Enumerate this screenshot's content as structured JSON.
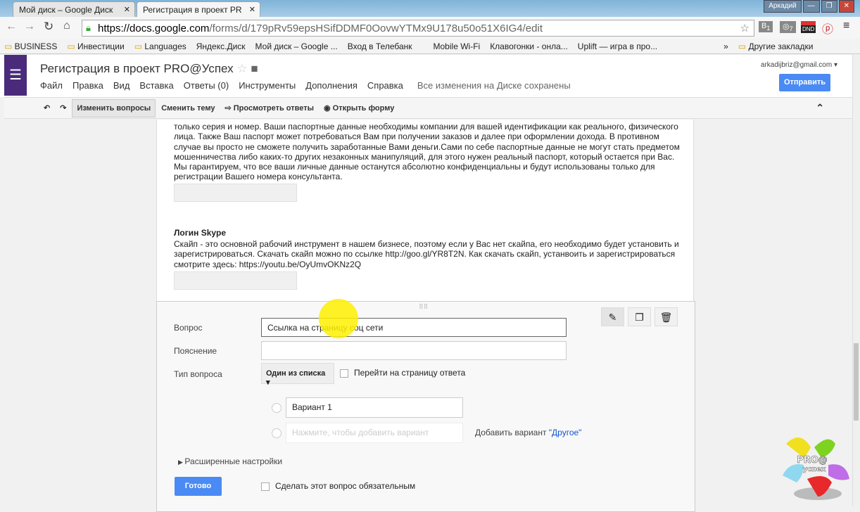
{
  "browser": {
    "tabs": [
      {
        "label": "Мой диск – Google Диск"
      },
      {
        "label": "Регистрация в проект PR"
      }
    ],
    "user": "Аркадий",
    "url_host": "https://docs.google.com",
    "url_path": "/forms/d/179pRv59epsHSifDDMF0OovwYTMx9U178u50o51X6IG4/edit",
    "bookmarks": [
      "BUSINESS",
      "Инвестиции",
      "Languages",
      "Яндекс.Диск",
      "Мой диск – Google ...",
      "Вход в Телебанк",
      "Mobile Wi-Fi",
      "Клавогонки - онла...",
      "Uplift — игра в про..."
    ],
    "other_bookmarks": "Другие закладки",
    "ext_badges": [
      "1",
      "7",
      "DND"
    ]
  },
  "app": {
    "title": "Регистрация в проект PRO@Успех",
    "menus": [
      "Файл",
      "Правка",
      "Вид",
      "Вставка",
      "Ответы (0)",
      "Инструменты",
      "Дополнения",
      "Справка"
    ],
    "saved_status": "Все изменения на Диске сохранены",
    "email": "arkadijbriz@gmail.com",
    "send_label": "Отправить"
  },
  "toolbar": {
    "edit_questions": "Изменить вопросы",
    "change_theme": "Сменить тему",
    "view_responses": "Просмотреть ответы",
    "open_form": "Открыть форму"
  },
  "form": {
    "passport_help": "только серия и номер. Ваши паспортные данные необходимы компании для вашей идентификации как реального, физического лица. Также Ваш паспорт может потребоваться Вам при получении заказов и далее при оформлении дохода. В противном случае вы просто не сможете получить заработанные Вами деньги.Сами по себе паспортные данные не могут стать предметом мошенничества либо каких-то других незаконных манипуляций, для этого нужен реальный паспорт, который остается при Вас. Мы гарантируем, что все ваши личные данные останутся абсолютно конфиденциальны и будут использованы только для регистрации Вашего номера консультанта.",
    "skype_title": "Логин Skype",
    "skype_help": "Скайп - это основной рабочий инструмент в нашем бизнесе, поэтому если у Вас нет скайпа, его необходимо будет установить и зарегистрироваться. Скачать скайп можно по ссылке http://goo.gl/YR8T2N. Как скачать скайп, устанвоить и зарегистрироваться смотрите здесь: https://youtu.be/OyUmvOKNz2Q",
    "editor": {
      "question_label": "Вопрос",
      "question_value": "Ссылка на страницу соц сети",
      "help_label": "Пояснение",
      "help_value": "",
      "type_label": "Тип вопроса",
      "type_value": "Один из списка",
      "goto_page": "Перейти на страницу ответа",
      "option1": "Вариант 1",
      "add_option_placeholder": "Нажмите, чтобы добавить вариант",
      "add_other_prefix": "Добавить вариант ",
      "add_other_link": "\"Другое\"",
      "advanced": "Расширенные настройки",
      "done": "Готово",
      "required": "Сделать этот вопрос обязательным"
    }
  },
  "logo": {
    "text": "PRO@ успех"
  }
}
